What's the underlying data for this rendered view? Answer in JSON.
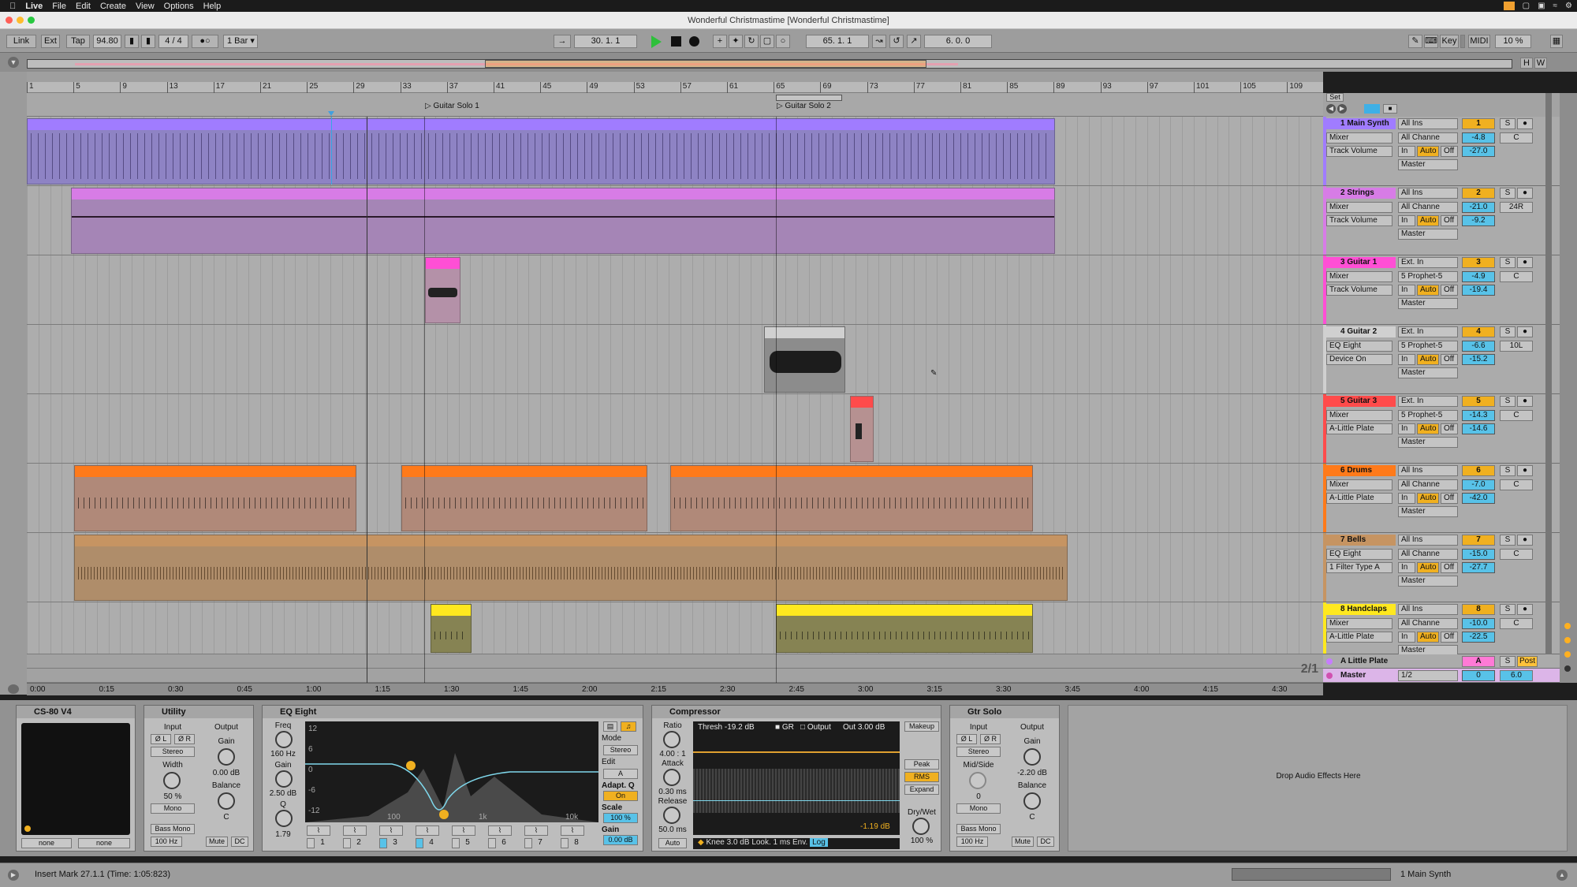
{
  "menubar": {
    "app": "Live",
    "items": [
      "File",
      "Edit",
      "Create",
      "View",
      "Options",
      "Help"
    ]
  },
  "window": {
    "title": "Wonderful Christmastime  [Wonderful Christmastime]"
  },
  "transport": {
    "link": "Link",
    "ext": "Ext",
    "tap": "Tap",
    "tempo": "94.80",
    "signature": "4 / 4",
    "quantize": "1 Bar",
    "arrangement_position": "30.  1.  1",
    "loop_start": "65.  1.  1",
    "loop_length": "6.  0.  0",
    "key": "Key",
    "midi": "MIDI",
    "cpu": "10 %"
  },
  "overview": {
    "h": "H",
    "w": "W"
  },
  "ruler": {
    "bars": [
      "1",
      "5",
      "9",
      "13",
      "17",
      "21",
      "25",
      "29",
      "33",
      "37",
      "41",
      "45",
      "49",
      "53",
      "57",
      "61",
      "65",
      "69",
      "73",
      "77",
      "81",
      "85",
      "89",
      "93",
      "97",
      "101",
      "105",
      "109"
    ]
  },
  "locators": [
    {
      "label": "Guitar Solo 1"
    },
    {
      "label": "Guitar Solo 2"
    }
  ],
  "set_button": "Set",
  "tracks": [
    {
      "name": "1 Main Synth",
      "color": "#a07cff",
      "num": "1",
      "input": "All Ins",
      "channel": "All Channe",
      "device": "Mixer",
      "param": "Track Volume",
      "output": "Master",
      "vol": "-4.8",
      "pan": "C",
      "send": "-27.0"
    },
    {
      "name": "2 Strings",
      "color": "#d77ce6",
      "num": "2",
      "input": "All Ins",
      "channel": "All Channe",
      "device": "Mixer",
      "param": "Track Volume",
      "output": "Master",
      "vol": "-21.0",
      "pan": "24R",
      "send": "-9.2"
    },
    {
      "name": "3 Guitar 1",
      "color": "#ff4fd5",
      "num": "3",
      "input": "Ext. In",
      "channel": "5 Prophet-5",
      "device": "Mixer",
      "param": "Track Volume",
      "output": "Master",
      "vol": "-4.9",
      "pan": "C",
      "send": "-19.4"
    },
    {
      "name": "4 Guitar 2",
      "color": "#d0d0d0",
      "num": "4",
      "input": "Ext. In",
      "channel": "5 Prophet-5",
      "device": "EQ Eight",
      "param": "Device On",
      "output": "Master",
      "vol": "-6.6",
      "pan": "10L",
      "send": "-15.2"
    },
    {
      "name": "5 Guitar 3",
      "color": "#ff4b4b",
      "num": "5",
      "input": "Ext. In",
      "channel": "5 Prophet-5",
      "device": "Mixer",
      "param": "A-Little Plate",
      "output": "Master",
      "vol": "-14.3",
      "pan": "C",
      "send": "-14.6"
    },
    {
      "name": "6 Drums",
      "color": "#ff7a1a",
      "num": "6",
      "input": "All Ins",
      "channel": "All Channe",
      "device": "Mixer",
      "param": "A-Little Plate",
      "output": "Master",
      "vol": "-7.0",
      "pan": "C",
      "send": "-42.0"
    },
    {
      "name": "7 Bells",
      "color": "#c69462",
      "num": "7",
      "input": "All Ins",
      "channel": "All Channe",
      "device": "EQ Eight",
      "param": "1 Filter Type A",
      "output": "Master",
      "vol": "-15.0",
      "pan": "C",
      "send": "-27.7"
    },
    {
      "name": "8 Handclaps",
      "color": "#ffe81f",
      "num": "8",
      "input": "All Ins",
      "channel": "All Channe",
      "device": "Mixer",
      "param": "A-Little Plate",
      "output": "Master",
      "vol": "-10.0",
      "pan": "C",
      "send": "-22.5"
    }
  ],
  "return_track": {
    "name": "A Little Plate",
    "num": "A",
    "s": "S",
    "post": "Post"
  },
  "master_track": {
    "name": "Master",
    "output": "1/2",
    "vol": "0",
    "pan": "6.0"
  },
  "track_buttons": {
    "in": "In",
    "auto": "Auto",
    "off": "Off",
    "s": "S"
  },
  "zoom_ratio": "2/1",
  "timebar": [
    "0:00",
    "0:15",
    "0:30",
    "0:45",
    "1:00",
    "1:15",
    "1:30",
    "1:45",
    "2:00",
    "2:15",
    "2:30",
    "2:45",
    "3:00",
    "3:15",
    "3:30",
    "3:45",
    "4:00",
    "4:15",
    "4:30"
  ],
  "devices": {
    "cs80": {
      "title": "CS-80 V4",
      "left": "none",
      "right": "none"
    },
    "utility": {
      "title": "Utility",
      "input": "Input",
      "output": "Output",
      "phase_l": "Ø L",
      "phase_r": "Ø R",
      "mode": "Stereo",
      "width_label": "Width",
      "width": "50 %",
      "mono": "Mono",
      "gain_label": "Gain",
      "gain": "0.00 dB",
      "balance_label": "Balance",
      "balance": "C",
      "bass_mono": "Bass Mono",
      "bass_freq": "100 Hz",
      "mute": "Mute",
      "dc": "DC"
    },
    "eq": {
      "title": "EQ Eight",
      "freq_label": "Freq",
      "freq": "160 Hz",
      "gain_label": "Gain",
      "gain": "2.50 dB",
      "q_label": "Q",
      "q": "1.79",
      "db_scale": [
        "12",
        "6",
        "0",
        "-6",
        "-12"
      ],
      "hz_scale": [
        "100",
        "1k",
        "10k"
      ],
      "mode_label": "Mode",
      "mode": "Stereo",
      "edit_label": "Edit",
      "edit": "A",
      "adapt_label": "Adapt. Q",
      "adapt": "On",
      "scale_label": "Scale",
      "scale": "100 %",
      "out_gain_label": "Gain",
      "out_gain": "0.00 dB",
      "bands": [
        "1",
        "2",
        "3",
        "4",
        "5",
        "6",
        "7",
        "8"
      ],
      "selected_band": "3"
    },
    "comp": {
      "title": "Compressor",
      "ratio_label": "Ratio",
      "ratio": "4.00 : 1",
      "attack_label": "Attack",
      "attack": "0.30 ms",
      "release_label": "Release",
      "release": "50.0 ms",
      "auto": "Auto",
      "thresh": "Thresh -19.2 dB",
      "gr": "GR",
      "output": "Output",
      "out": "Out 3.00 dB",
      "gr_value": "-1.19 dB",
      "makeup": "Makeup",
      "peak": "Peak",
      "rms": "RMS",
      "expand": "Expand",
      "drywet_label": "Dry/Wet",
      "drywet": "100 %",
      "knee": "Knee 3.0 dB",
      "look": "Look. 1 ms",
      "env": "Env.",
      "log": "Log"
    },
    "gtr": {
      "title": "Gtr Solo",
      "input": "Input",
      "output": "Output",
      "phase_l": "Ø L",
      "phase_r": "Ø R",
      "mode": "Stereo",
      "midside_label": "Mid/Side",
      "midside": "0",
      "mono": "Mono",
      "gain_label": "Gain",
      "gain": "-2.20 dB",
      "balance_label": "Balance",
      "balance": "C",
      "bass_mono": "Bass Mono",
      "bass_freq": "100 Hz",
      "mute": "Mute",
      "dc": "DC"
    },
    "drop_label": "Drop Audio Effects Here"
  },
  "status": {
    "message": "Insert Mark 27.1.1 (Time: 1:05:823)",
    "track": "1 Main Synth"
  }
}
